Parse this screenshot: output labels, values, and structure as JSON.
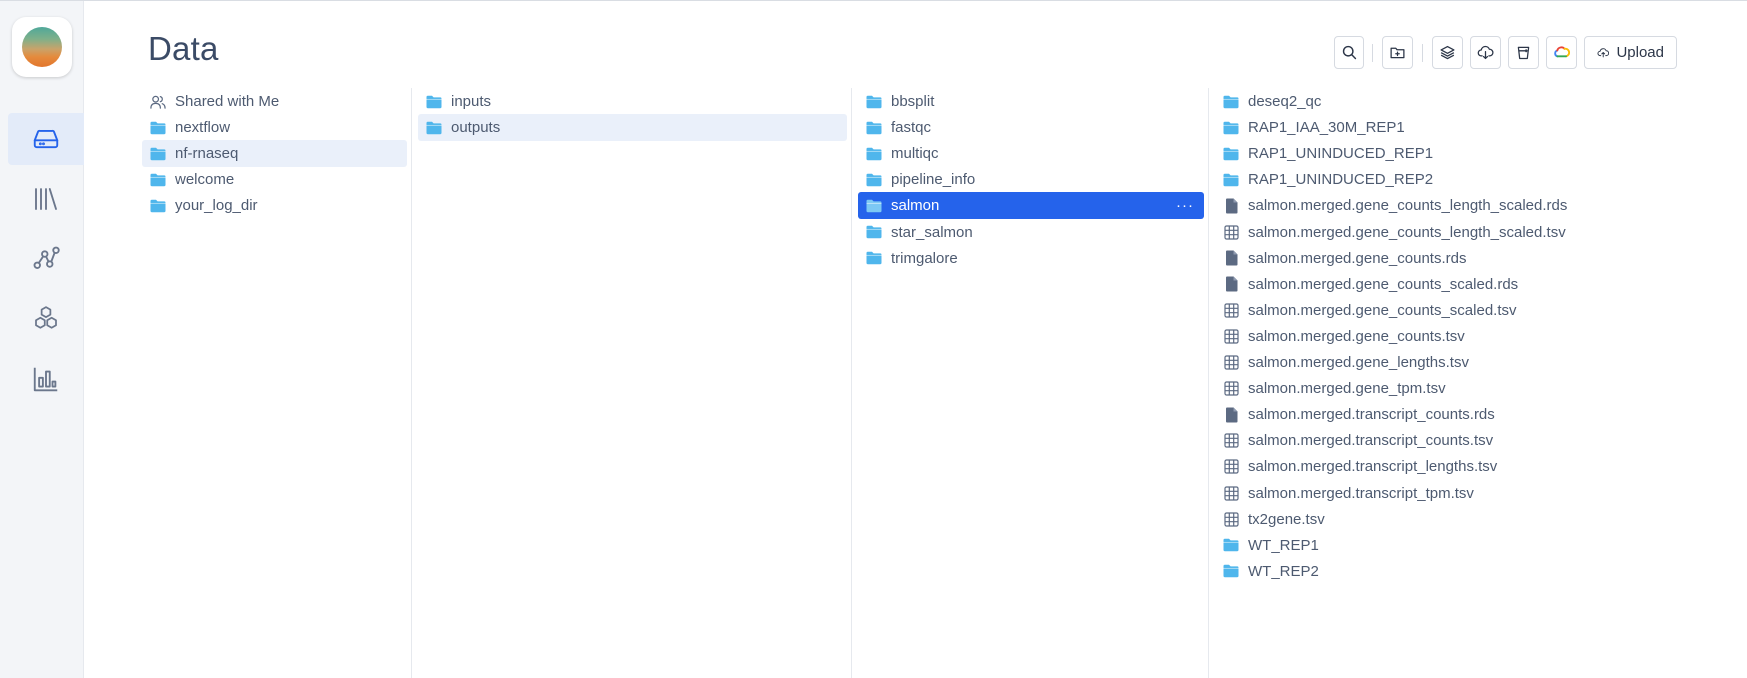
{
  "app": {
    "title": "Data"
  },
  "toolbar": {
    "search_icon": "search-icon",
    "new_folder_icon": "folder-plus-icon",
    "layers_icon": "layers-icon",
    "cloud_download_icon": "cloud-download-icon",
    "s3_icon": "bucket-icon",
    "gcloud_icon": "google-cloud-icon",
    "upload_label": "Upload"
  },
  "columns": {
    "col1": [
      {
        "label": "Shared with Me",
        "icon": "users-icon"
      },
      {
        "label": "nextflow",
        "icon": "folder-icon"
      },
      {
        "label": "nf-rnaseq",
        "icon": "folder-icon",
        "selected": "light"
      },
      {
        "label": "welcome",
        "icon": "folder-icon"
      },
      {
        "label": "your_log_dir",
        "icon": "folder-icon"
      }
    ],
    "col2": [
      {
        "label": "inputs",
        "icon": "folder-icon"
      },
      {
        "label": "outputs",
        "icon": "folder-icon",
        "selected": "light"
      }
    ],
    "col3": [
      {
        "label": "bbsplit",
        "icon": "folder-icon"
      },
      {
        "label": "fastqc",
        "icon": "folder-icon"
      },
      {
        "label": "multiqc",
        "icon": "folder-icon"
      },
      {
        "label": "pipeline_info",
        "icon": "folder-icon"
      },
      {
        "label": "salmon",
        "icon": "folder-icon",
        "selected": "dark",
        "more": "···"
      },
      {
        "label": "star_salmon",
        "icon": "folder-icon"
      },
      {
        "label": "trimgalore",
        "icon": "folder-icon"
      }
    ],
    "col4": [
      {
        "label": "deseq2_qc",
        "icon": "folder-icon"
      },
      {
        "label": "RAP1_IAA_30M_REP1",
        "icon": "folder-icon"
      },
      {
        "label": "RAP1_UNINDUCED_REP1",
        "icon": "folder-icon"
      },
      {
        "label": "RAP1_UNINDUCED_REP2",
        "icon": "folder-icon"
      },
      {
        "label": "salmon.merged.gene_counts_length_scaled.rds",
        "icon": "file-icon"
      },
      {
        "label": "salmon.merged.gene_counts_length_scaled.tsv",
        "icon": "table-icon"
      },
      {
        "label": "salmon.merged.gene_counts.rds",
        "icon": "file-icon"
      },
      {
        "label": "salmon.merged.gene_counts_scaled.rds",
        "icon": "file-icon"
      },
      {
        "label": "salmon.merged.gene_counts_scaled.tsv",
        "icon": "table-icon"
      },
      {
        "label": "salmon.merged.gene_counts.tsv",
        "icon": "table-icon"
      },
      {
        "label": "salmon.merged.gene_lengths.tsv",
        "icon": "table-icon"
      },
      {
        "label": "salmon.merged.gene_tpm.tsv",
        "icon": "table-icon"
      },
      {
        "label": "salmon.merged.transcript_counts.rds",
        "icon": "file-icon"
      },
      {
        "label": "salmon.merged.transcript_counts.tsv",
        "icon": "table-icon"
      },
      {
        "label": "salmon.merged.transcript_lengths.tsv",
        "icon": "table-icon"
      },
      {
        "label": "salmon.merged.transcript_tpm.tsv",
        "icon": "table-icon"
      },
      {
        "label": "tx2gene.tsv",
        "icon": "table-icon"
      },
      {
        "label": "WT_REP1",
        "icon": "folder-icon"
      },
      {
        "label": "WT_REP2",
        "icon": "folder-icon"
      }
    ]
  },
  "colors": {
    "accent": "#2563eb",
    "folder": "#4fb6ec",
    "light_selected": "#eaf0fa"
  }
}
